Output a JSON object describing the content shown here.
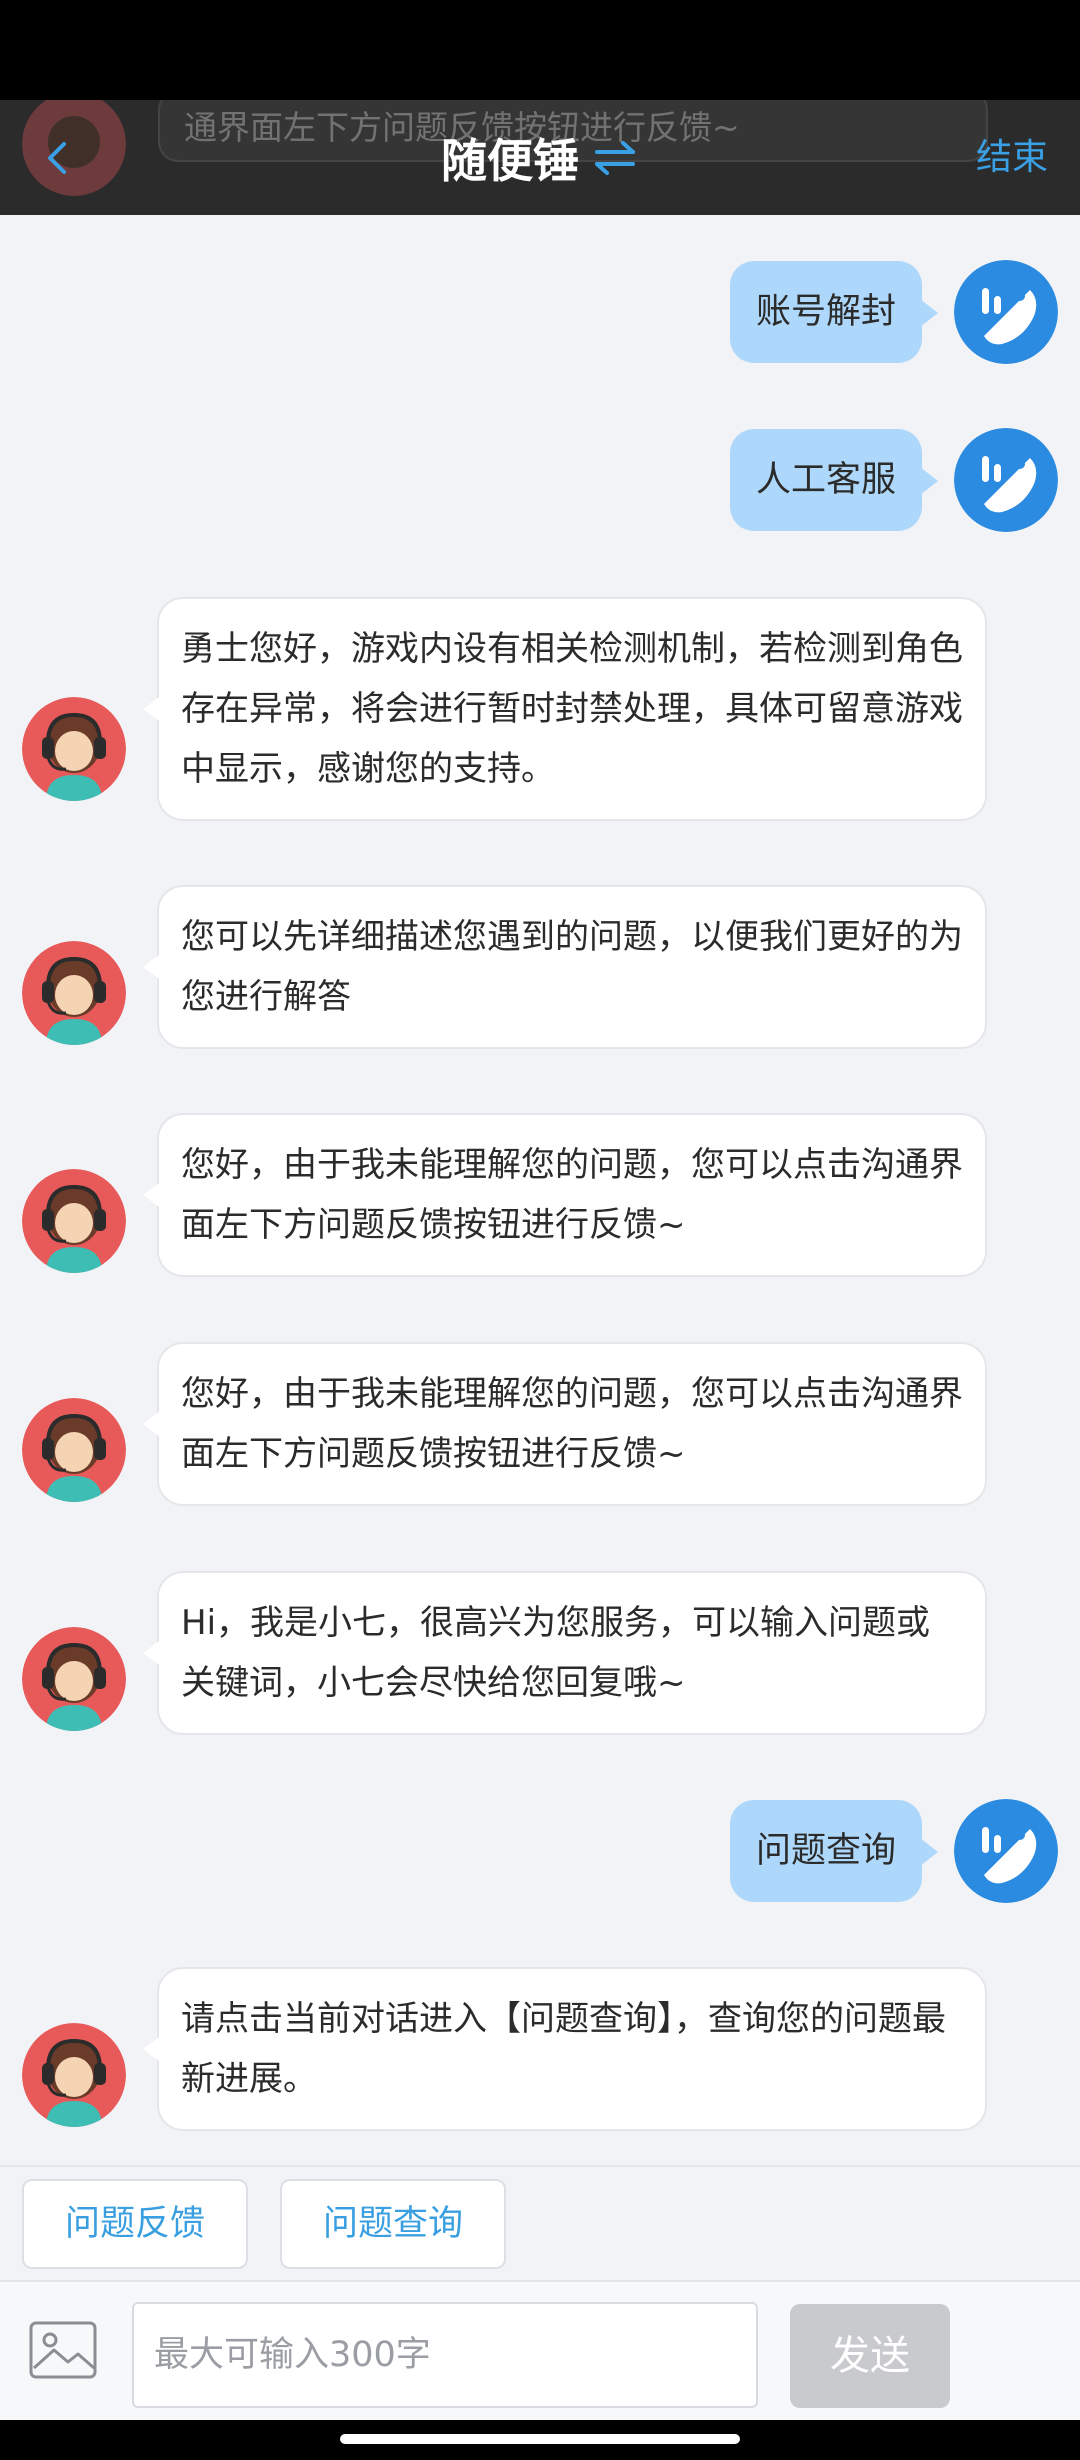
{
  "header": {
    "title": "随便锤",
    "end_label": "结束",
    "ghost_text": "通界面左下方问题反馈按钮进行反馈~"
  },
  "messages": [
    {
      "from": "user",
      "text": "账号解封"
    },
    {
      "from": "user",
      "text": "人工客服"
    },
    {
      "from": "bot",
      "text": "勇士您好，游戏内设有相关检测机制，若检测到角色存在异常，将会进行暂时封禁处理，具体可留意游戏中显示，感谢您的支持。"
    },
    {
      "from": "bot",
      "text": "您可以先详细描述您遇到的问题，以便我们更好的为您进行解答"
    },
    {
      "from": "bot",
      "text": "您好，由于我未能理解您的问题，您可以点击沟通界面左下方问题反馈按钮进行反馈~"
    },
    {
      "from": "bot",
      "text": "您好，由于我未能理解您的问题，您可以点击沟通界面左下方问题反馈按钮进行反馈~"
    },
    {
      "from": "bot",
      "text": "Hi，我是小七，很高兴为您服务，可以输入问题或关键词，小七会尽快给您回复哦~"
    },
    {
      "from": "user",
      "text": "问题查询"
    },
    {
      "from": "bot",
      "text": "请点击当前对话进入【问题查询】，查询您的问题最新进展。"
    }
  ],
  "quick_actions": [
    "问题反馈",
    "问题查询"
  ],
  "input": {
    "placeholder": "最大可输入300字",
    "send_label": "发送"
  },
  "icons": {
    "back": "back-chevron-icon",
    "switch": "switch-arrows-icon",
    "user_avatar": "phone-logo-icon",
    "bot_avatar": "agent-headset-icon",
    "image": "image-icon"
  },
  "colors": {
    "accent": "#3aa0e6",
    "user_bubble": "#aed8fb",
    "header_bg": "#2b2b2b",
    "page_bg": "#f2f3f6",
    "send_disabled": "#c9cacd"
  }
}
